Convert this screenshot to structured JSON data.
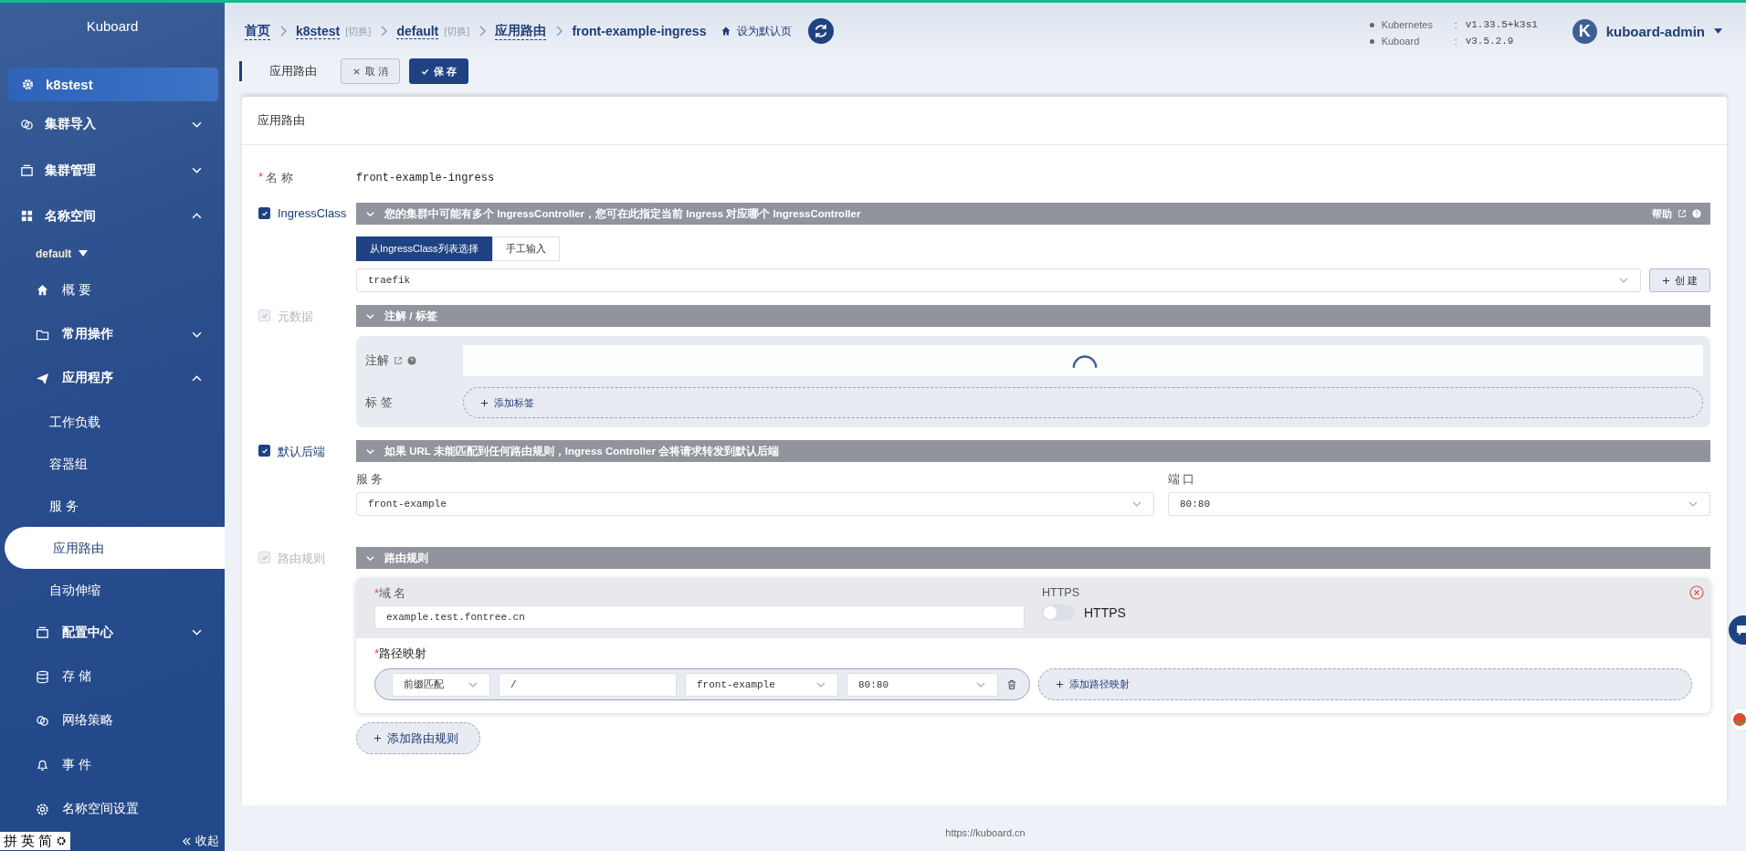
{
  "sidebar": {
    "title": "Kuboard",
    "cluster": "k8stest",
    "items": [
      {
        "label": "集群导入",
        "expanded": false
      },
      {
        "label": "集群管理",
        "expanded": false
      },
      {
        "label": "名称空间",
        "expanded": true,
        "namespace": "default",
        "children": [
          {
            "label": "概 要",
            "selected": false
          },
          {
            "label": "常用操作",
            "expanded": false
          },
          {
            "label": "应用程序",
            "expanded": true,
            "children": [
              {
                "label": "工作负载",
                "selected": false
              },
              {
                "label": "容器组",
                "selected": false
              },
              {
                "label": "服 务",
                "selected": false
              },
              {
                "label": "应用路由",
                "selected": true
              },
              {
                "label": "自动伸缩",
                "selected": false
              }
            ]
          },
          {
            "label": "配置中心",
            "expanded": false
          },
          {
            "label": "存 储",
            "selected": false
          },
          {
            "label": "网络策略",
            "selected": false
          },
          {
            "label": "事 件",
            "selected": false
          },
          {
            "label": "名称空间设置",
            "selected": false
          }
        ]
      }
    ],
    "collapse": "收起"
  },
  "ime_bar": [
    "拼",
    "英",
    "简"
  ],
  "breadcrumb": [
    {
      "label": "首页",
      "link": true
    },
    {
      "label": "k8stest",
      "link": true,
      "switch": "[切换]"
    },
    {
      "label": "default",
      "link": true,
      "switch": "[切换]"
    },
    {
      "label": "应用路由",
      "link": true
    },
    {
      "label": "front-example-ingress",
      "link": false
    }
  ],
  "set_default": "设为默认页",
  "versions": [
    {
      "name": "Kubernetes",
      "separator": ":",
      "value": "v1.33.5+k3s1"
    },
    {
      "name": "Kuboard",
      "separator": ":",
      "value": "v3.5.2.9"
    }
  ],
  "user": {
    "avatar": "K",
    "name": "kuboard-admin"
  },
  "toolbar": {
    "title": "应用路由",
    "cancel": "取 消",
    "save": "保 存"
  },
  "card_title": "应用路由",
  "name_field": {
    "required_mark": "*",
    "label": "名 称",
    "value": "front-example-ingress"
  },
  "ingress_class": {
    "label": "IngressClass",
    "checked": true,
    "disabled": false,
    "banner": "您的集群中可能有多个 IngressController，您可在此指定当前 Ingress 对应哪个 IngressController",
    "help": "帮助",
    "tabs": [
      {
        "label": "从IngressClass列表选择",
        "selected": true
      },
      {
        "label": "手工输入",
        "selected": false
      }
    ],
    "value": "traefik",
    "create": "创 建"
  },
  "metadata": {
    "label": "元数据",
    "checked": true,
    "disabled": true,
    "banner": "注解 / 标签",
    "annotations_label": "注解",
    "labels_label": "标 签",
    "add_label": "添加标签"
  },
  "default_backend": {
    "label": "默认后端",
    "checked": true,
    "disabled": false,
    "banner": "如果 URL 未能匹配到任何路由规则，Ingress Controller 会将请求转发到默认后端",
    "service_label": "服 务",
    "service": "front-example",
    "port_label": "端 口",
    "port": "80:80"
  },
  "rules": {
    "label": "路由规则",
    "checked": true,
    "disabled": true,
    "banner": "路由规则",
    "items": [
      {
        "host_required_mark": "*",
        "host_label": "域 名",
        "host": "example.test.fontree.cn",
        "https_label": "HTTPS",
        "https": false,
        "https_text": "HTTPS",
        "paths_required_mark": "*",
        "paths_label": "路径映射",
        "paths": [
          {
            "match": "前缀匹配",
            "path": "/",
            "service": "front-example",
            "port": "80:80"
          }
        ],
        "add_path": "添加路径映射"
      }
    ],
    "add_rule": "添加路由规则"
  },
  "footer": "https://kuboard.cn"
}
